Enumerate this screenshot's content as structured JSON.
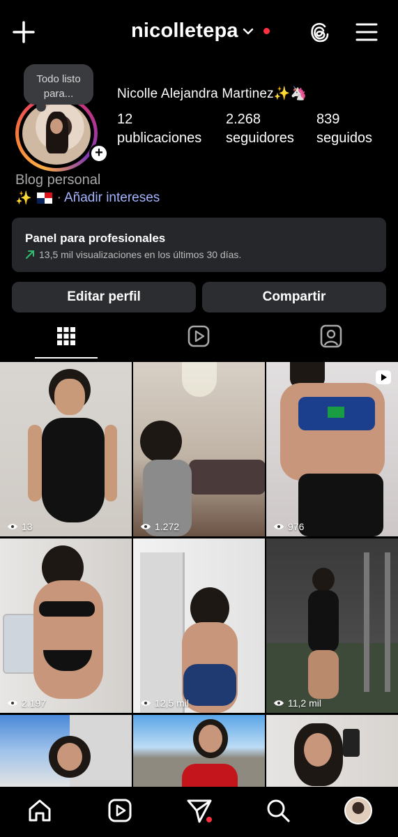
{
  "header": {
    "username": "nicolletepa",
    "icons": [
      "plus-icon",
      "chevron-down-icon",
      "threads-icon",
      "menu-icon"
    ]
  },
  "profile": {
    "note": "Todo listo para...",
    "full_name": "Nicolle Alejandra Martinez✨🦄",
    "stats": [
      {
        "value": "12",
        "label": "publicaciones"
      },
      {
        "value": "2.268",
        "label": "seguidores"
      },
      {
        "value": "839",
        "label": "seguidos"
      }
    ],
    "category": "Blog personal",
    "bio_prefix": "✨",
    "bio_separator": "·",
    "bio_link": "Añadir intereses"
  },
  "panel": {
    "title": "Panel para profesionales",
    "subtitle": "13,5 mil visualizaciones en los últimos 30 días."
  },
  "buttons": {
    "edit": "Editar perfil",
    "share": "Compartir"
  },
  "tabs": [
    "grid-icon",
    "reels-icon",
    "tagged-icon"
  ],
  "grid": {
    "posts": [
      {
        "views": "13"
      },
      {
        "views": "1.272"
      },
      {
        "views": "976",
        "is_reel": true
      },
      {
        "views": "2.197"
      },
      {
        "views": "12,5 mil"
      },
      {
        "views": "11,2 mil"
      },
      {
        "views": ""
      },
      {
        "views": ""
      },
      {
        "views": ""
      }
    ]
  },
  "bottom_nav": [
    "home-icon",
    "reels-icon",
    "messages-icon",
    "search-icon",
    "profile-avatar"
  ],
  "colors": {
    "background": "#000000",
    "surface": "#26272b",
    "link": "#a4b4ff",
    "notification": "#ff3040",
    "trend": "#2fbf71"
  }
}
